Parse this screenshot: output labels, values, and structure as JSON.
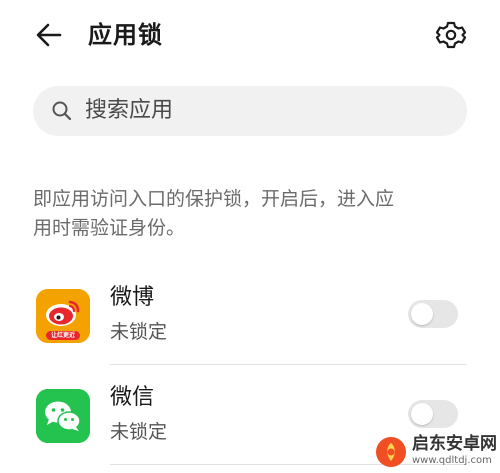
{
  "header": {
    "title": "应用锁",
    "back_icon": "arrow-left-icon",
    "settings_icon": "gear-icon"
  },
  "search": {
    "placeholder": "搜索应用",
    "icon": "search-icon"
  },
  "description": {
    "line1": "即应用访问入口的保护锁，开启后，进入应",
    "line2": "用时需验证身份。"
  },
  "apps": [
    {
      "name": "微博",
      "status": "未锁定",
      "icon_label": "让红更近",
      "locked": false,
      "brand_color": "#f2a100"
    },
    {
      "name": "微信",
      "status": "未锁定",
      "locked": false,
      "brand_color": "#24c34f"
    }
  ],
  "watermark": {
    "text": "启东安卓网",
    "url": "www.qdltdj.com"
  },
  "colors": {
    "background": "#ffffff",
    "search_bg": "#f1f1f1",
    "toggle_off": "#e6e6e6",
    "description_text": "#6b6b6b"
  }
}
